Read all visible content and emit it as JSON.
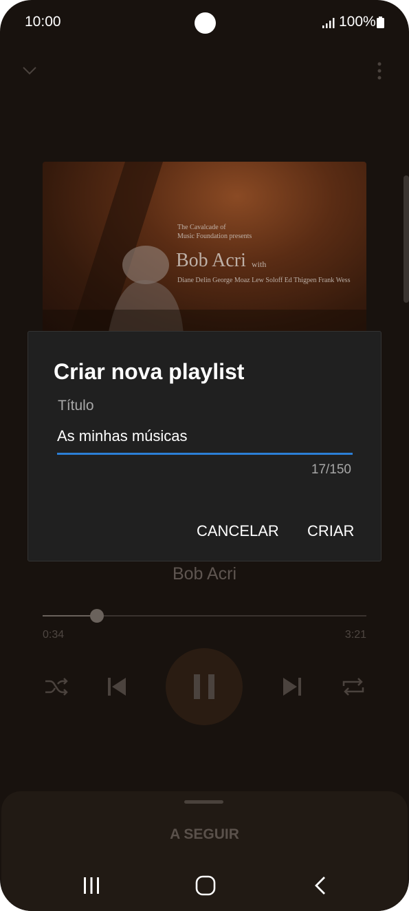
{
  "status_bar": {
    "time": "10:00",
    "battery": "100%"
  },
  "player": {
    "album_art_text": {
      "line1": "The Cavalcade of",
      "line2": "Music Foundation presents",
      "title": "Bob Acri",
      "title_suffix": "with",
      "credits": "Diane Delin George Moaz Lew Soloff  Ed Thigpen Frank Wess"
    },
    "artist": "Bob Acri",
    "elapsed": "0:34",
    "total": "3:21",
    "progress_fraction": 0.168,
    "up_next_label": "A SEGUIR"
  },
  "dialog": {
    "title": "Criar nova playlist",
    "field_label": "Título",
    "field_value": "As minhas músicas",
    "counter": "17/150",
    "cancel_label": "CANCELAR",
    "create_label": "CRIAR"
  },
  "colors": {
    "background": "#18120e",
    "dialog_bg": "#202020",
    "accent_underline": "#2b7fd6"
  }
}
